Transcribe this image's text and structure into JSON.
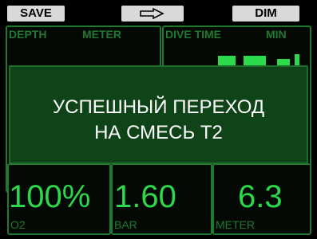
{
  "softkeys": {
    "left_label": "SAVE",
    "right_label": "DIM",
    "middle_icon": "right-arrow-icon"
  },
  "upper": {
    "depth_label": "DEPTH",
    "depth_unit": "METER",
    "time_label": "DIVE TIME",
    "time_unit": "MIN"
  },
  "banner": {
    "line1": "УСПЕШНЫЙ ПЕРЕХОД",
    "line2": "НА СМЕСЬ T2"
  },
  "gas": {
    "o2_value": "100%",
    "o2_label": "O2",
    "ppo2_value": "1.60",
    "ppo2_label": "BAR",
    "mod_value": "6.3",
    "mod_label": "METER"
  },
  "colors": {
    "accent": "#2bd94b",
    "label": "#1f7a30",
    "banner_bg": "#0e4417"
  }
}
